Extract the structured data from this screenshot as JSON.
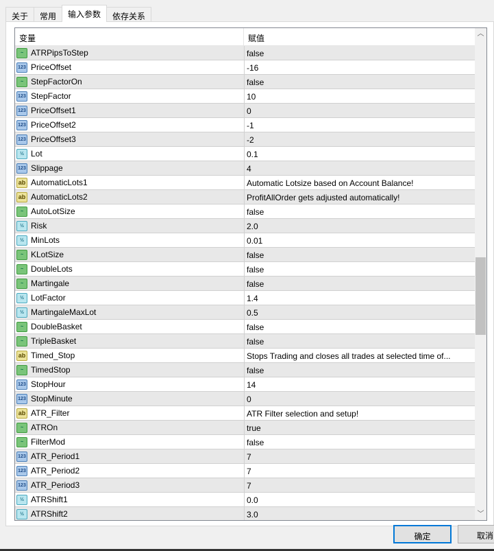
{
  "tabs": [
    "关于",
    "常用",
    "输入参数",
    "依存关系"
  ],
  "active_tab": 2,
  "columns": {
    "variable": "变量",
    "value": "赋值"
  },
  "rows": [
    {
      "type": "bool",
      "name": "ATRPipsToStep",
      "value": "false"
    },
    {
      "type": "int",
      "name": "PriceOffset",
      "value": "-16"
    },
    {
      "type": "bool",
      "name": "StepFactorOn",
      "value": "false"
    },
    {
      "type": "int",
      "name": "StepFactor",
      "value": "10"
    },
    {
      "type": "int",
      "name": "PriceOffset1",
      "value": "0"
    },
    {
      "type": "int",
      "name": "PriceOffset2",
      "value": "-1"
    },
    {
      "type": "int",
      "name": "PriceOffset3",
      "value": "-2"
    },
    {
      "type": "dbl",
      "name": "Lot",
      "value": "0.1"
    },
    {
      "type": "int",
      "name": "Slippage",
      "value": "4"
    },
    {
      "type": "str",
      "name": "AutomaticLots1",
      "value": "Automatic Lotsize based on Account Balance!"
    },
    {
      "type": "str",
      "name": "AutomaticLots2",
      "value": "ProfitAllOrder gets adjusted automatically!"
    },
    {
      "type": "bool",
      "name": "AutoLotSize",
      "value": "false"
    },
    {
      "type": "dbl",
      "name": "Risk",
      "value": "2.0"
    },
    {
      "type": "dbl",
      "name": "MinLots",
      "value": "0.01"
    },
    {
      "type": "bool",
      "name": "KLotSize",
      "value": "false"
    },
    {
      "type": "bool",
      "name": "DoubleLots",
      "value": "false"
    },
    {
      "type": "bool",
      "name": "Martingale",
      "value": "false"
    },
    {
      "type": "dbl",
      "name": "LotFactor",
      "value": "1.4"
    },
    {
      "type": "dbl",
      "name": "MartingaleMaxLot",
      "value": "0.5"
    },
    {
      "type": "bool",
      "name": "DoubleBasket",
      "value": "false"
    },
    {
      "type": "bool",
      "name": "TripleBasket",
      "value": "false"
    },
    {
      "type": "str",
      "name": "Timed_Stop",
      "value": "Stops Trading and closes all trades at selected time of..."
    },
    {
      "type": "bool",
      "name": "TimedStop",
      "value": "false"
    },
    {
      "type": "int",
      "name": "StopHour",
      "value": "14"
    },
    {
      "type": "int",
      "name": "StopMinute",
      "value": "0"
    },
    {
      "type": "str",
      "name": "ATR_Filter",
      "value": "ATR Filter selection and setup!"
    },
    {
      "type": "bool",
      "name": "ATROn",
      "value": "true"
    },
    {
      "type": "bool",
      "name": "FilterMod",
      "value": "false"
    },
    {
      "type": "int",
      "name": "ATR_Period1",
      "value": "7"
    },
    {
      "type": "int",
      "name": "ATR_Period2",
      "value": "7"
    },
    {
      "type": "int",
      "name": "ATR_Period3",
      "value": "7"
    },
    {
      "type": "dbl",
      "name": "ATRShift1",
      "value": "0.0"
    },
    {
      "type": "dbl",
      "name": "ATRShift2",
      "value": "3.0"
    }
  ],
  "icons": {
    "bool": "~",
    "int": "123",
    "dbl": "½",
    "str": "ab"
  },
  "scroll_position_fraction": 0.5,
  "buttons": {
    "ok": "确定",
    "cancel": "取消"
  }
}
